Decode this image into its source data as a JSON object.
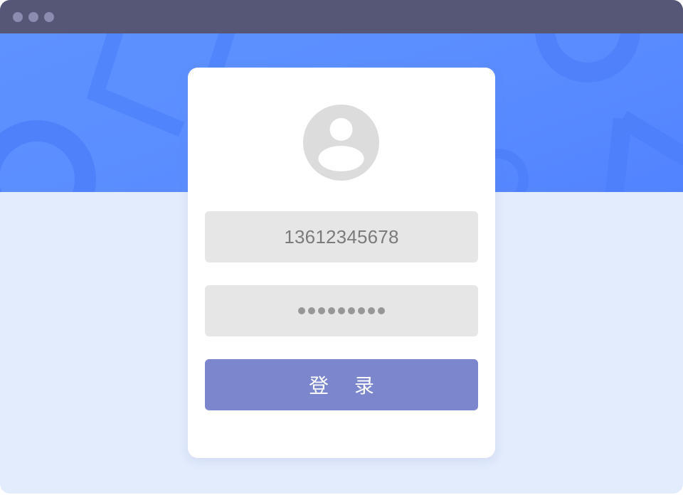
{
  "window": {
    "titlebar_dots": [
      "dot-1",
      "dot-2",
      "dot-3"
    ]
  },
  "login_form": {
    "avatar_icon": "user-avatar-icon",
    "phone_value": "13612345678",
    "password_masked_length": 9,
    "login_label": "登 录"
  },
  "colors": {
    "titlebar": "#565777",
    "banner": "#5a8cff",
    "page_background": "#e3ecfd",
    "field_background": "#e6e6e6",
    "login_button": "#7b86cc"
  }
}
